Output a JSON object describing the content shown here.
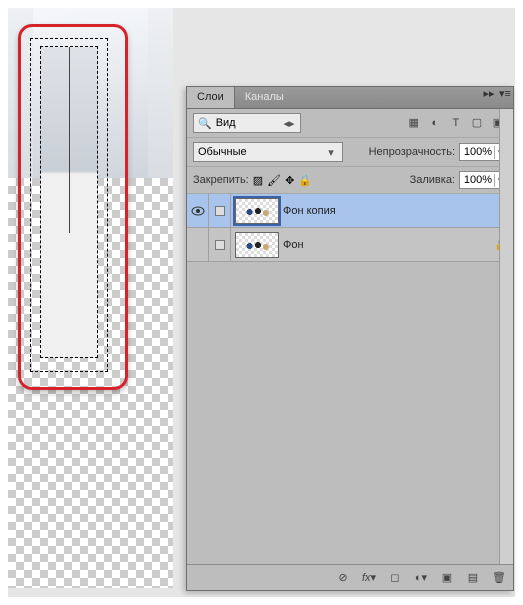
{
  "tabs": {
    "layers": "Слои",
    "channels": "Каналы"
  },
  "filter": {
    "label": "Вид"
  },
  "icons_row": [
    "image",
    "fx",
    "text",
    "shape",
    "smart"
  ],
  "blend": {
    "mode": "Обычные",
    "opacity_label": "Непрозрачность:",
    "opacity_value": "100%"
  },
  "lock": {
    "label": "Закрепить:",
    "fill_label": "Заливка:",
    "fill_value": "100%"
  },
  "layers": [
    {
      "name": "Фон копия",
      "visible": true,
      "selected": true,
      "locked": false
    },
    {
      "name": "Фон",
      "visible": false,
      "selected": false,
      "locked": true
    }
  ],
  "footer_icons": [
    "link",
    "fx",
    "mask",
    "adjust",
    "group",
    "new",
    "trash"
  ]
}
